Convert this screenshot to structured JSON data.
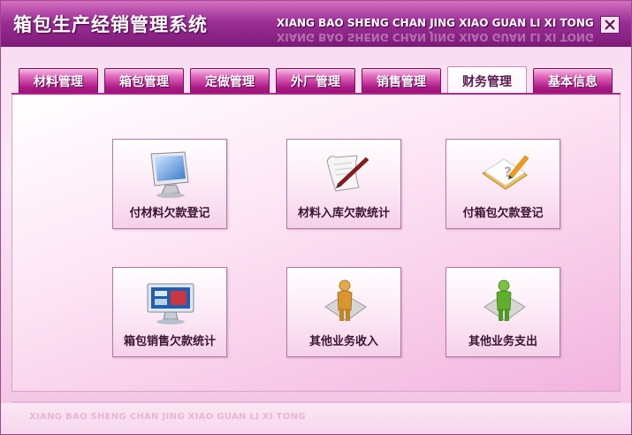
{
  "window": {
    "title_cn": "箱包生产经销管理系统",
    "title_en": "XIANG BAO SHENG CHAN JING XIAO GUAN LI XI TONG",
    "close_icon": "close-icon"
  },
  "tabs": [
    {
      "label": "材料管理",
      "active": false
    },
    {
      "label": "箱包管理",
      "active": false
    },
    {
      "label": "定做管理",
      "active": false
    },
    {
      "label": "外厂管理",
      "active": false
    },
    {
      "label": "销售管理",
      "active": false
    },
    {
      "label": "财务管理",
      "active": true
    },
    {
      "label": "基本信息",
      "active": false
    }
  ],
  "tiles": [
    {
      "label": "付材料欠款登记",
      "icon": "monitor-icon"
    },
    {
      "label": "材料入库欠款统计",
      "icon": "scroll-pen-icon"
    },
    {
      "label": "付箱包欠款登记",
      "icon": "notebook-pencil-icon"
    },
    {
      "label": "箱包销售欠款统计",
      "icon": "monitor-chart-icon"
    },
    {
      "label": "其他业务收入",
      "icon": "person-gold-icon"
    },
    {
      "label": "其他业务支出",
      "icon": "person-green-icon"
    }
  ],
  "footer": {
    "text": "XIANG BAO SHENG CHAN JING XIAO GUAN LI XI TONG"
  },
  "colors": {
    "titlebar": "#9c2f95",
    "tab": "#b01d8a",
    "tab_active_text": "#5a1a50"
  }
}
